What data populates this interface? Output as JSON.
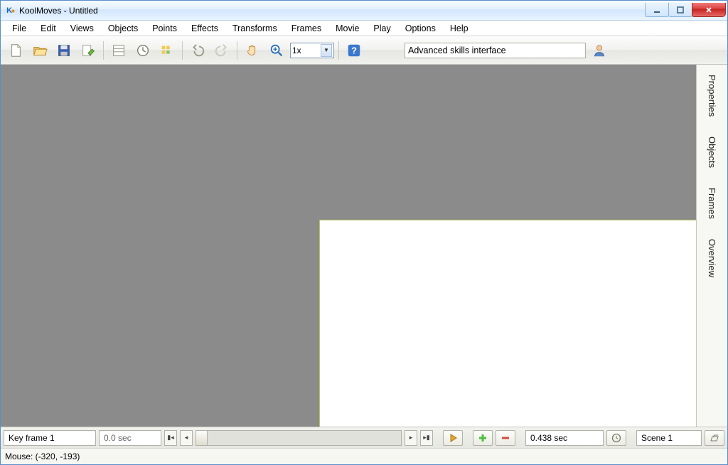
{
  "window": {
    "title": "KoolMoves - Untitled"
  },
  "menu": {
    "items": [
      "File",
      "Edit",
      "Views",
      "Objects",
      "Points",
      "Effects",
      "Transforms",
      "Frames",
      "Movie",
      "Play",
      "Options",
      "Help"
    ]
  },
  "toolbar": {
    "zoom_value": "1x",
    "skills_text": "Advanced skills interface"
  },
  "side_tabs": {
    "items": [
      "Properties",
      "Objects",
      "Frames",
      "Overview"
    ]
  },
  "timeline": {
    "keyframe_label": "Key frame 1",
    "time_label": "0.0 sec",
    "duration_label": "0.438 sec",
    "scene_label": "Scene 1"
  },
  "status": {
    "mouse_label": "Mouse: (-320, -193)"
  }
}
